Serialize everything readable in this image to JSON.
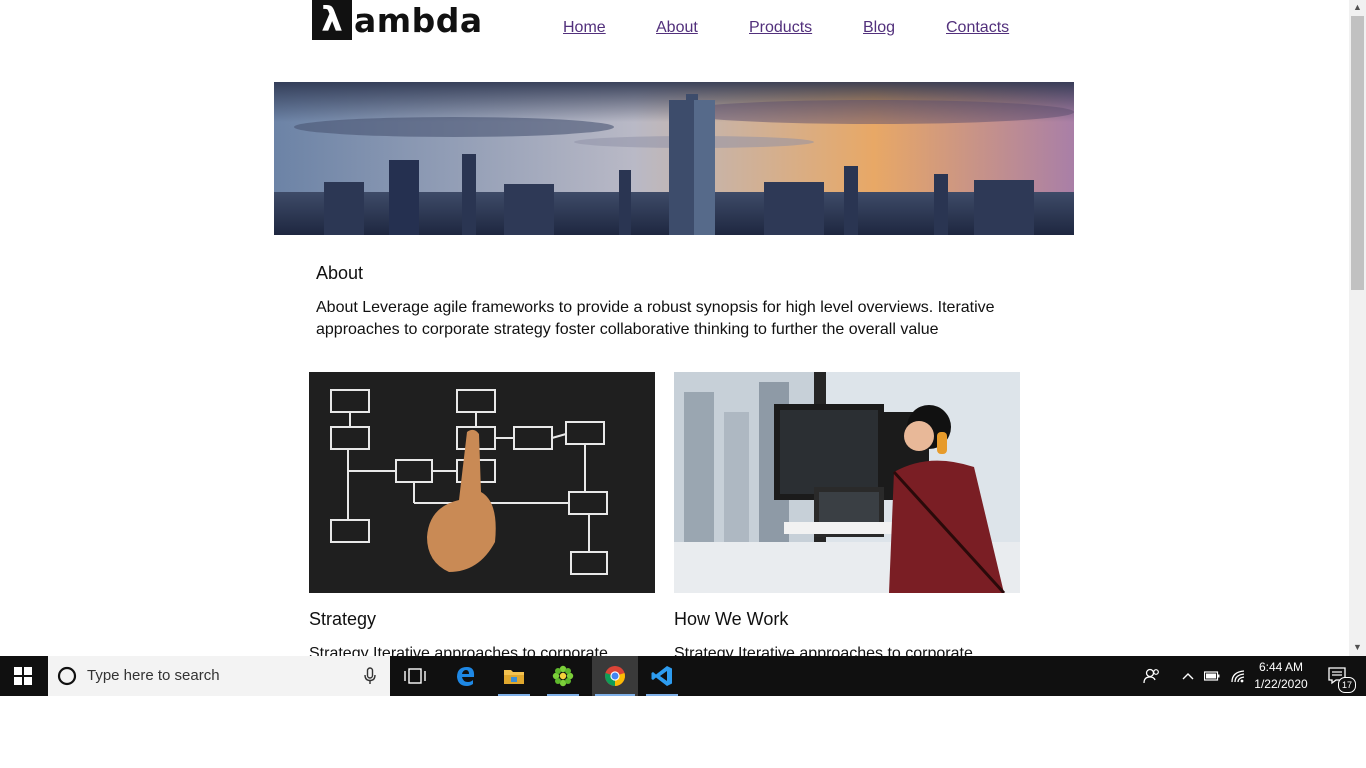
{
  "site": {
    "logo_symbol": "λ",
    "logo_text": "ambda"
  },
  "nav": {
    "items": [
      {
        "label": "Home"
      },
      {
        "label": "About"
      },
      {
        "label": "Products"
      },
      {
        "label": "Blog"
      },
      {
        "label": "Contacts"
      }
    ]
  },
  "about": {
    "title": "About",
    "text": "About Leverage agile frameworks to provide a robust synopsis for high level overviews. Iterative approaches to corporate strategy foster collaborative thinking to further the overall value"
  },
  "cards": [
    {
      "title": "Strategy",
      "text": "Strategy Iterative approaches to corporate"
    },
    {
      "title": "How We Work",
      "text": "Strategy Iterative approaches to corporate"
    }
  ],
  "taskbar": {
    "search_placeholder": "Type here to search",
    "time": "6:44 AM",
    "date": "1/22/2020",
    "notification_count": "17"
  },
  "colors": {
    "link": "#52307c",
    "taskbar": "#101010",
    "accent": "#7fb0e8"
  }
}
